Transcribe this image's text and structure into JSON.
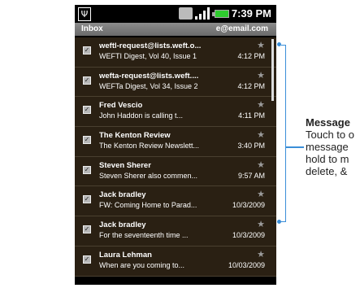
{
  "status": {
    "usb_glyph": "Ψ",
    "time": "7:39 PM"
  },
  "header": {
    "title": "Inbox",
    "account": "e@email.com"
  },
  "messages": [
    {
      "from": "weftl-request@lists.weft.o...",
      "subject": "WEFTI Digest, Vol 40, Issue 1",
      "date": "4:12 PM"
    },
    {
      "from": "wefta-request@lists.weft....",
      "subject": "WEFTa Digest, Vol 34, Issue 2",
      "date": "4:12 PM"
    },
    {
      "from": "Fred Vescio",
      "subject": "John Haddon is calling t...",
      "date": "4:11 PM"
    },
    {
      "from": "The Kenton Review",
      "subject": "The Kenton Review Newslett...",
      "date": "3:40 PM"
    },
    {
      "from": "Steven Sherer",
      "subject": "Steven Sherer also commen...",
      "date": "9:57 AM"
    },
    {
      "from": "Jack bradley",
      "subject": "FW: Coming Home to Parad...",
      "date": "10/3/2009"
    },
    {
      "from": "Jack bradley",
      "subject": "For the seventeenth time ...",
      "date": "10/3/2009"
    },
    {
      "from": "Laura Lehman",
      "subject": "When are you coming to...",
      "date": "10/03/2009"
    }
  ],
  "callout": {
    "title": "Message",
    "line1": "Touch to o",
    "line2": "message",
    "line3": "hold to m",
    "line4": "delete, &"
  },
  "colors": {
    "row_bg": "#2a2013",
    "accent": "#3a8ed8",
    "battery": "#2ecc2e"
  }
}
